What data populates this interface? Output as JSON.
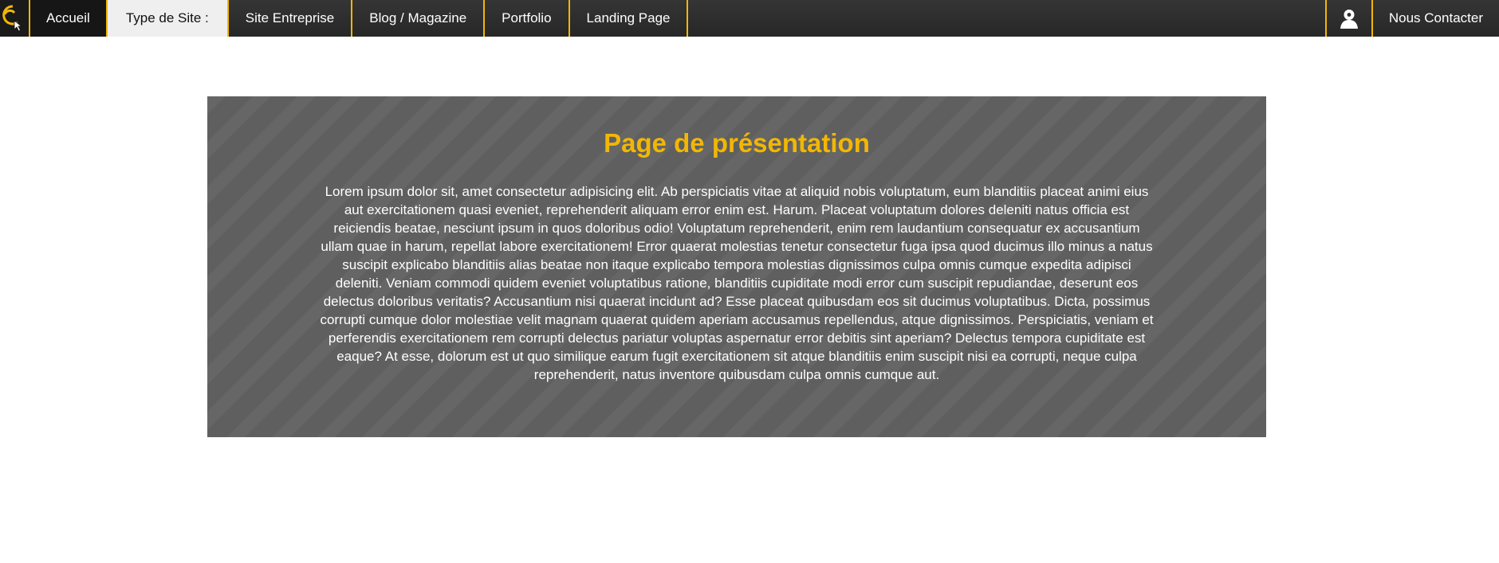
{
  "nav": {
    "items": [
      {
        "label": "Accueil"
      },
      {
        "label": "Type de Site :"
      },
      {
        "label": "Site Entreprise"
      },
      {
        "label": "Blog / Magazine"
      },
      {
        "label": "Portfolio"
      },
      {
        "label": "Landing Page"
      }
    ],
    "contact_label": "Nous Contacter",
    "user_icon": "user-icon",
    "logo_icon": "logo-icon"
  },
  "hero": {
    "title": "Page de présentation",
    "body": "Lorem ipsum dolor sit, amet consectetur adipisicing elit. Ab perspiciatis vitae at aliquid nobis voluptatum, eum blanditiis placeat animi eius aut exercitationem quasi eveniet, reprehenderit aliquam error enim est. Harum. Placeat voluptatum dolores deleniti natus officia est reiciendis beatae, nesciunt ipsum in quos doloribus odio! Voluptatum reprehenderit, enim rem laudantium consequatur ex accusantium ullam quae in harum, repellat labore exercitationem! Error quaerat molestias tenetur consectetur fuga ipsa quod ducimus illo minus a natus suscipit explicabo blanditiis alias beatae non itaque explicabo tempora molestias dignissimos culpa omnis cumque expedita adipisci deleniti. Veniam commodi quidem eveniet voluptatibus ratione, blanditiis cupiditate modi error cum suscipit repudiandae, deserunt eos delectus doloribus veritatis? Accusantium nisi quaerat incidunt ad? Esse placeat quibusdam eos sit ducimus voluptatibus. Dicta, possimus corrupti cumque dolor molestiae velit magnam quaerat quidem aperiam accusamus repellendus, atque dignissimos. Perspiciatis, veniam et perferendis exercitationem rem corrupti delectus pariatur voluptas aspernatur error debitis sint aperiam? Delectus tempora cupiditate est eaque? At esse, dolorum est ut quo similique earum fugit exercitationem sit atque blanditiis enim suscipit nisi ea corrupti, neque culpa reprehenderit, natus inventore quibusdam culpa omnis cumque aut."
  },
  "colors": {
    "accent": "#f2b705",
    "nav_bg": "#2e2e2e",
    "hero_bg": "#5f5f5f"
  }
}
